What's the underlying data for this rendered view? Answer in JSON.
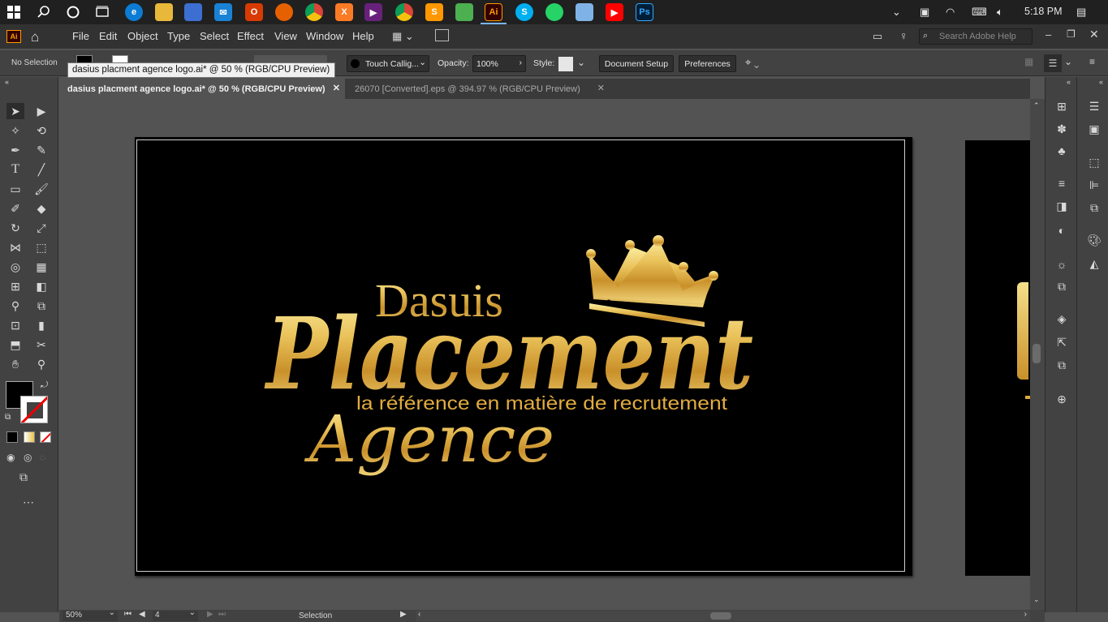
{
  "taskbar": {
    "time": "5:18 PM",
    "pinned": [
      "windows-start",
      "search",
      "cortana",
      "task-view",
      "edge",
      "file-explorer",
      "store",
      "mail",
      "office",
      "firefox",
      "chrome",
      "xampp",
      "visual-studio",
      "chrome-2",
      "sublime",
      "app-green",
      "illustrator",
      "skype",
      "whatsapp",
      "notepad",
      "youtube",
      "photoshop"
    ],
    "illustrator_label": "Ai",
    "photoshop_label": "Ps"
  },
  "menubar": {
    "app_badge": "Ai",
    "items": [
      "File",
      "Edit",
      "Object",
      "Type",
      "Select",
      "Effect",
      "View",
      "Window",
      "Help"
    ],
    "search_placeholder": "Search Adobe Help"
  },
  "controlbar": {
    "selection_status": "No Selection",
    "brush_name": "Touch Callig...",
    "opacity_label": "Opacity:",
    "opacity_value": "100%",
    "style_label": "Style:",
    "document_setup": "Document Setup",
    "preferences": "Preferences"
  },
  "tooltip": "dasius placment agence logo.ai* @ 50 % (RGB/CPU Preview)",
  "tabs": [
    {
      "label": "dasius placment agence logo.ai* @ 50 % (RGB/CPU Preview)",
      "active": true
    },
    {
      "label": "26070 [Converted].eps @ 394.97 % (RGB/CPU Preview)",
      "active": false
    }
  ],
  "artwork": {
    "line1": "Dasuis",
    "line2": "Placement",
    "tagline": "la référence en matière de recrutement",
    "line3": "Agence"
  },
  "statusbar": {
    "zoom": "50%",
    "artboard_number": "4",
    "tool_status": "Selection"
  },
  "colors": {
    "gold_light": "#f6e08a",
    "gold_mid": "#d9a93c",
    "gold_dark": "#8a5a12",
    "ui_bg": "#535353",
    "panel_bg": "#424242"
  }
}
